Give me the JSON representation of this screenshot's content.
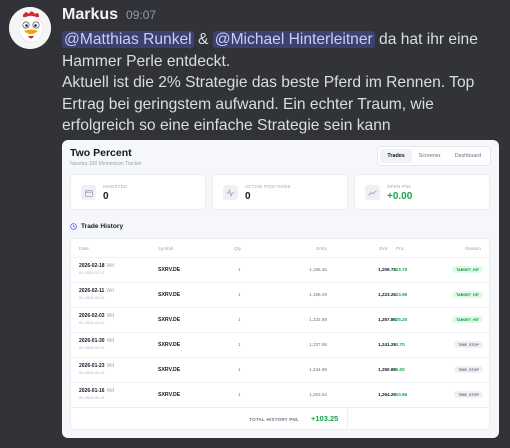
{
  "message": {
    "username": "Markus",
    "timestamp": "09:07",
    "mention_1": "@Matthias Runkel",
    "connector": "&",
    "mention_2": "@Michael Hinterleitner",
    "line1_tail": "da hat ihr eine",
    "line2": "Hammer Perle entdeckt.",
    "line3": "Aktuell ist die 2% Strategie das beste Pferd im Rennen. Top Ertrag bei geringstem aufwand. Ein echter Traum, wie erfolgreich so eine einfache Strategie sein kann"
  },
  "embed": {
    "title": "Two Percent",
    "subtitle": "Nasdaq-100 Momentum Tracker",
    "tabs": [
      {
        "label": "Trades",
        "active": true
      },
      {
        "label": "Screener",
        "active": false
      },
      {
        "label": "Dashboard",
        "active": false
      }
    ],
    "stats": [
      {
        "label": "INVESTED",
        "value": "0",
        "icon": "calendar-icon",
        "color": "#6b7280"
      },
      {
        "label": "ACTIVE POSITIONS",
        "value": "0",
        "icon": "activity-icon",
        "color": "#6b7280"
      },
      {
        "label": "OPEN PNL",
        "value": "+0.00",
        "icon": "trend-up-icon",
        "color": "#16a34a"
      }
    ],
    "trade_history_title": "Trade History",
    "columns": [
      "Date",
      "Symbol",
      "Qty",
      "Entry",
      "Exit",
      "PnL",
      "Reason"
    ],
    "rows": [
      {
        "date": "2026-02-18",
        "day": "Wd",
        "sub": "IN: 2026-02-17",
        "symbol": "SXRV.DE",
        "qty": "1",
        "entry": "1,185.45",
        "exit": "1,209.73",
        "pnl": "+23.70",
        "reason": "TARGET_HIT"
      },
      {
        "date": "2026-02-11",
        "day": "Wd",
        "sub": "IN: 2026-02-09",
        "symbol": "SXRV.DE",
        "qty": "1",
        "entry": "1,199.29",
        "exit": "1,223.26",
        "pnl": "+23.96",
        "reason": "TARGET_HIT"
      },
      {
        "date": "2026-02-03",
        "day": "Wd",
        "sub": "IN: 2026-02-02",
        "symbol": "SXRV.DE",
        "qty": "1",
        "entry": "1,232.89",
        "exit": "1,257.80",
        "pnl": "+25.20",
        "reason": "TARGET_HIT"
      },
      {
        "date": "2026-01-30",
        "day": "Wd",
        "sub": "IN: 2026-01-29",
        "symbol": "SXRV.DE",
        "qty": "1",
        "entry": "1,237.58",
        "exit": "1,241.29",
        "pnl": "+3.70",
        "reason": "TIME_STOP"
      },
      {
        "date": "2026-01-23",
        "day": "Wd",
        "sub": "IN: 2026-01-19",
        "symbol": "SXRV.DE",
        "qty": "1",
        "entry": "1,244.89",
        "exit": "1,250.89",
        "pnl": "+6.00",
        "reason": "TIME_STOP"
      },
      {
        "date": "2026-01-16",
        "day": "Wd",
        "sub": "IN: 2026-01-12",
        "symbol": "SXRV.DE",
        "qty": "1",
        "entry": "1,253.54",
        "exit": "1,264.20",
        "pnl": "+10.66",
        "reason": "TIME_STOP"
      }
    ],
    "total_label": "TOTAL HISTORY PNL",
    "total_value": "+103.25"
  }
}
